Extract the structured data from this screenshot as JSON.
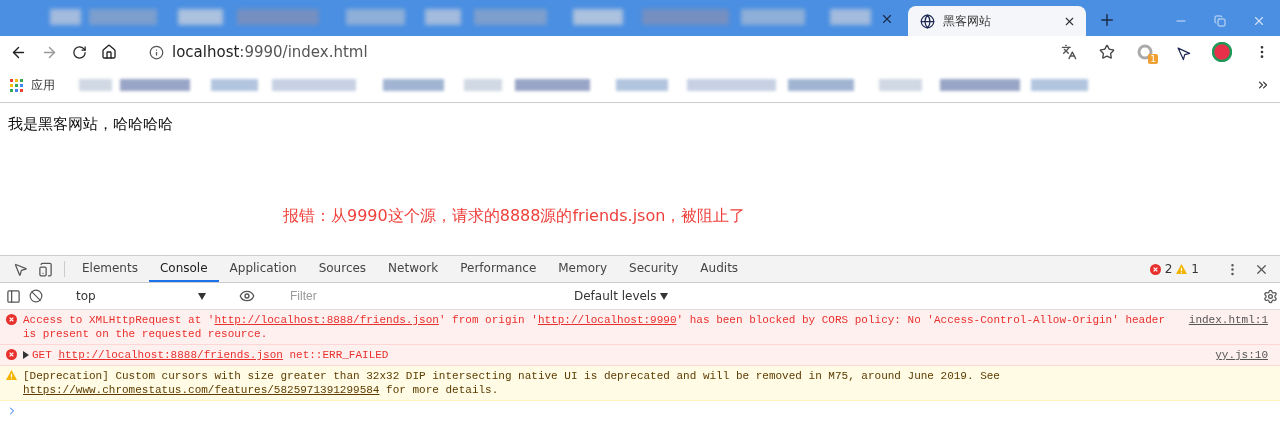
{
  "browser": {
    "tabs": [
      {
        "title": "黑客网站",
        "selected": true
      }
    ],
    "address": {
      "host": "localhost",
      "rest": ":9990/index.html"
    },
    "extension_badge": "1",
    "bookmarks": [
      {
        "label": "应用"
      }
    ]
  },
  "page": {
    "heading": "我是黑客网站，哈哈哈哈",
    "annotation": "报错：从9990这个源，请求的8888源的friends.json，被阻止了"
  },
  "devtools": {
    "tabs": [
      {
        "label": "Elements",
        "selected": false
      },
      {
        "label": "Console",
        "selected": true
      },
      {
        "label": "Application",
        "selected": false
      },
      {
        "label": "Sources",
        "selected": false
      },
      {
        "label": "Network",
        "selected": false
      },
      {
        "label": "Performance",
        "selected": false
      },
      {
        "label": "Memory",
        "selected": false
      },
      {
        "label": "Security",
        "selected": false
      },
      {
        "label": "Audits",
        "selected": false
      }
    ],
    "error_count": "2",
    "warning_count": "1",
    "console_toolbar": {
      "context": "top",
      "filter_placeholder": "Filter",
      "levels": "Default levels"
    },
    "messages": [
      {
        "kind": "error",
        "expandable": false,
        "source": "index.html:1",
        "parts": [
          {
            "kind": "text",
            "text": "Access to XMLHttpRequest at '"
          },
          {
            "kind": "link",
            "text": "http://localhost:8888/friends.json"
          },
          {
            "kind": "text",
            "text": "' from origin '"
          },
          {
            "kind": "link",
            "text": "http://localhost:9990"
          },
          {
            "kind": "text",
            "text": "' has been blocked by CORS policy: No 'Access-Control-Allow-Origin' header is present on the requested resource."
          }
        ]
      },
      {
        "kind": "error",
        "expandable": true,
        "source": "yy.js:10",
        "parts": [
          {
            "kind": "text",
            "text": "GET "
          },
          {
            "kind": "link",
            "text": "http://localhost:8888/friends.json"
          },
          {
            "kind": "text",
            "text": " net::ERR_FAILED"
          }
        ]
      },
      {
        "kind": "warning",
        "expandable": false,
        "parts": [
          {
            "kind": "text",
            "text": "[Deprecation] Custom cursors with size greater than 32x32 DIP intersecting native UI is deprecated and will be removed in M75, around June 2019. See "
          },
          {
            "kind": "link",
            "text": "https://www.chromestatus.com/features/5825971391299584"
          },
          {
            "kind": "text",
            "text": " for more details."
          }
        ]
      }
    ]
  }
}
